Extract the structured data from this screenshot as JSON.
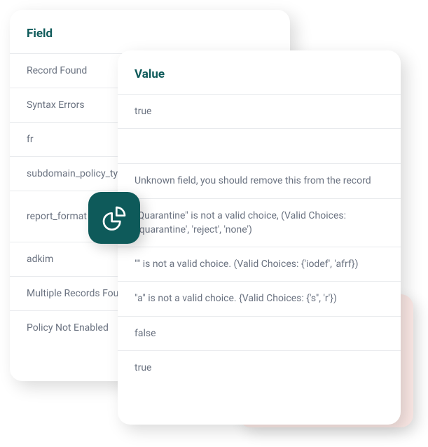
{
  "fieldCard": {
    "header": "Field",
    "rows": [
      "Record Found",
      "Syntax Errors",
      "fr",
      "subdomain_policy_type",
      "report_format",
      "adkim",
      "Multiple Records Found",
      "Policy Not Enabled"
    ]
  },
  "valueCard": {
    "header": "Value",
    "rows": [
      "true",
      "",
      "Unknown field, you should remove this from the record",
      "\"Quarantine\" is not a valid choice, (Valid Choices: {'quarantine', 'reject', 'none')",
      "\"\" is not a valid choice. (Valid Choices: {'iodef', 'afrf})",
      "\"a\" is not a valid choice. {Valid Choices: {'s'', 'r'})",
      "false",
      "true"
    ]
  }
}
